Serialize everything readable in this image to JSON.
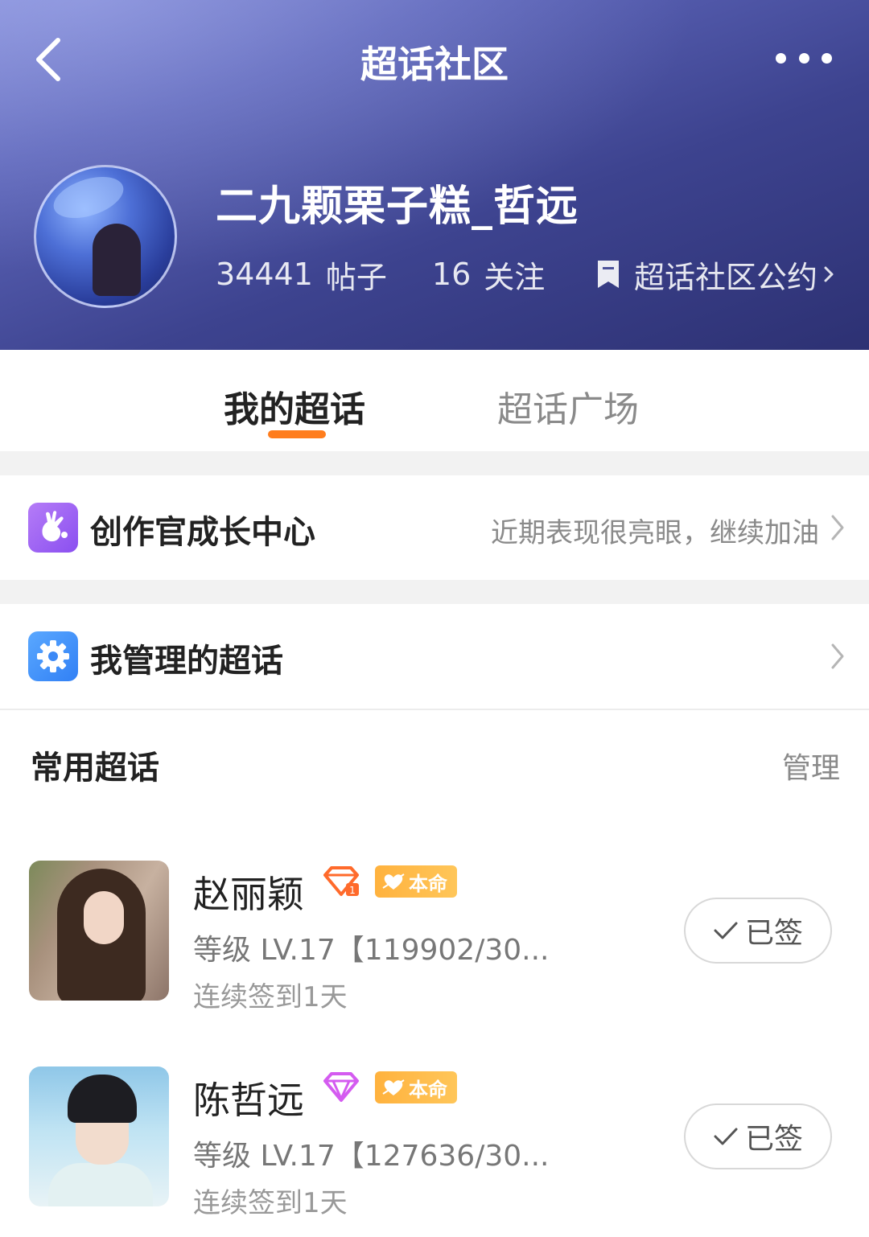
{
  "header": {
    "title": "超话社区",
    "community_name": "二九颗栗子糕_哲远",
    "posts_count": "34441",
    "posts_label": "帖子",
    "follow_count": "16",
    "follow_label": "关注",
    "rules_label": "超话社区公约"
  },
  "tabs": [
    {
      "label": "我的超话",
      "active": true
    },
    {
      "label": "超话广场",
      "active": false
    }
  ],
  "accent_color": "#ff7d1d",
  "creator_center": {
    "label": "创作官成长中心",
    "hint": "近期表现很亮眼，继续加油"
  },
  "managed": {
    "label": "我管理的超话"
  },
  "frequent": {
    "title": "常用超话",
    "manage_label": "管理",
    "items": [
      {
        "name": "赵丽颖",
        "gem_color": "orange",
        "badge_label": "本命",
        "level": "等级 LV.17【119902/30...",
        "streak": "连续签到1天",
        "button_label": "已签"
      },
      {
        "name": "陈哲远",
        "gem_color": "purple",
        "badge_label": "本命",
        "level": "等级 LV.17【127636/30...",
        "streak": "连续签到1天",
        "button_label": "已签"
      }
    ]
  }
}
